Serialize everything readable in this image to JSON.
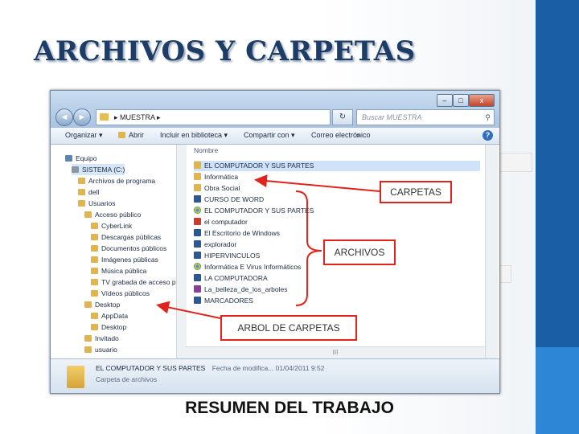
{
  "slide": {
    "title": "ARCHIVOS Y CARPETAS",
    "subtitle": "RESUMEN DEL TRABAJO",
    "accent_color": "#1a5fa6"
  },
  "window": {
    "controls": {
      "minimize": "–",
      "maximize": "□",
      "close": "x"
    },
    "nav": {
      "back": "◄",
      "forward": "►"
    },
    "address": {
      "path": "▸ MUESTRA ▸"
    },
    "refresh_icon": "refresh-icon",
    "search_placeholder": "Buscar MUESTRA",
    "toolbar": {
      "organizar": "Organizar ▾",
      "abrir": "Abrir",
      "incluir": "Incluir en biblioteca ▾",
      "compartir": "Compartir con ▾",
      "correo": "Correo electrónico",
      "more": "»",
      "help": "?"
    },
    "tree": [
      {
        "label": "Equipo",
        "icon": "computer-icon"
      },
      {
        "label": "SISTEMA (C:)",
        "icon": "drive-icon"
      },
      {
        "label": "Archivos de programa",
        "icon": "folder-icon"
      },
      {
        "label": "dell",
        "icon": "folder-icon"
      },
      {
        "label": "Usuarios",
        "icon": "folder-icon"
      },
      {
        "label": "Acceso público",
        "icon": "folder-icon"
      },
      {
        "label": "CyberLink",
        "icon": "folder-icon"
      },
      {
        "label": "Descargas públicas",
        "icon": "folder-icon"
      },
      {
        "label": "Documentos públicos",
        "icon": "folder-icon"
      },
      {
        "label": "Imágenes públicas",
        "icon": "folder-icon"
      },
      {
        "label": "Música pública",
        "icon": "folder-icon"
      },
      {
        "label": "TV grabada de acceso públ",
        "icon": "folder-icon"
      },
      {
        "label": "Vídeos públicos",
        "icon": "folder-icon"
      },
      {
        "label": "Desktop",
        "icon": "folder-icon"
      },
      {
        "label": "AppData",
        "icon": "folder-icon"
      },
      {
        "label": "Desktop",
        "icon": "folder-icon"
      },
      {
        "label": "Invitado",
        "icon": "folder-icon"
      },
      {
        "label": "usuario",
        "icon": "folder-icon"
      }
    ],
    "files_header": "Nombre",
    "files": [
      {
        "name": "EL COMPUTADOR Y SUS PARTES",
        "icon": "folder-icon"
      },
      {
        "name": "Informática",
        "icon": "folder-icon"
      },
      {
        "name": "Obra Social",
        "icon": "folder-icon"
      },
      {
        "name": "CURSO DE WORD",
        "icon": "word-icon"
      },
      {
        "name": "EL COMPUTADOR Y SUS PARTES",
        "icon": "chrome-icon"
      },
      {
        "name": "el computador",
        "icon": "pdf-icon"
      },
      {
        "name": "El Escritorio de Windows",
        "icon": "word-icon"
      },
      {
        "name": "explorador",
        "icon": "word-icon"
      },
      {
        "name": "HIPERVINCULOS",
        "icon": "word-icon"
      },
      {
        "name": "Informática E Virus Informáticos",
        "icon": "chrome-icon"
      },
      {
        "name": "LA COMPUTADORA",
        "icon": "word-icon"
      },
      {
        "name": "La_belleza_de_los_arboles",
        "icon": "winrar-icon"
      },
      {
        "name": "MARCADORES",
        "icon": "word-icon"
      }
    ],
    "hscroll_grip": "III",
    "status": {
      "name": "EL COMPUTADOR Y SUS PARTES",
      "date_text": "Fecha de modifica... 01/04/2011 9:52",
      "type": "Carpeta de archivos"
    }
  },
  "callouts": {
    "carpetas": "CARPETAS",
    "archivos": "ARCHIVOS",
    "arbol": "ARBOL DE CARPETAS"
  },
  "annotation_color": "#e0241b"
}
